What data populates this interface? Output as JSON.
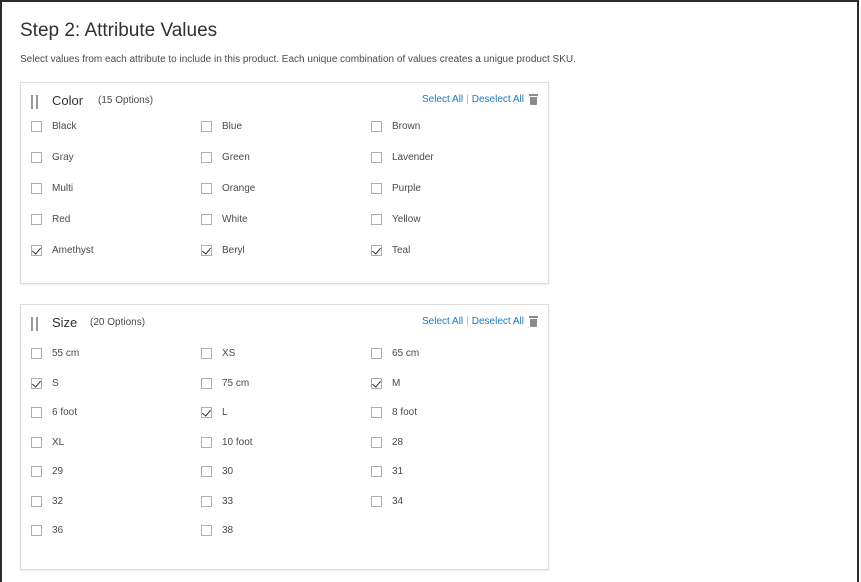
{
  "step": {
    "title": "Step 2: Attribute Values",
    "description": "Select values from each attribute to include in this product. Each unique combination of values creates a unigue product SKU."
  },
  "attributes": [
    {
      "name": "Color",
      "count_label": "(15 Options)",
      "select_all_label": "Select All",
      "deselect_all_label": "Deselect All",
      "options": [
        {
          "label": "Black",
          "checked": false
        },
        {
          "label": "Blue",
          "checked": false
        },
        {
          "label": "Brown",
          "checked": false
        },
        {
          "label": "Gray",
          "checked": false
        },
        {
          "label": "Green",
          "checked": false
        },
        {
          "label": "Lavender",
          "checked": false
        },
        {
          "label": "Multi",
          "checked": false
        },
        {
          "label": "Orange",
          "checked": false
        },
        {
          "label": "Purple",
          "checked": false
        },
        {
          "label": "Red",
          "checked": false
        },
        {
          "label": "White",
          "checked": false
        },
        {
          "label": "Yellow",
          "checked": false
        },
        {
          "label": "Amethyst",
          "checked": true
        },
        {
          "label": "Beryl",
          "checked": true
        },
        {
          "label": "Teal",
          "checked": true
        }
      ]
    },
    {
      "name": "Size",
      "count_label": "(20 Options)",
      "select_all_label": "Select All",
      "deselect_all_label": "Deselect All",
      "options": [
        {
          "label": "55 cm",
          "checked": false
        },
        {
          "label": "XS",
          "checked": false
        },
        {
          "label": "65 cm",
          "checked": false
        },
        {
          "label": "S",
          "checked": true
        },
        {
          "label": "75 cm",
          "checked": false
        },
        {
          "label": "M",
          "checked": true
        },
        {
          "label": "6 foot",
          "checked": false
        },
        {
          "label": "L",
          "checked": true
        },
        {
          "label": "8 foot",
          "checked": false
        },
        {
          "label": "XL",
          "checked": false
        },
        {
          "label": "10 foot",
          "checked": false
        },
        {
          "label": "28",
          "checked": false
        },
        {
          "label": "29",
          "checked": false
        },
        {
          "label": "30",
          "checked": false
        },
        {
          "label": "31",
          "checked": false
        },
        {
          "label": "32",
          "checked": false
        },
        {
          "label": "33",
          "checked": false
        },
        {
          "label": "34",
          "checked": false
        },
        {
          "label": "36",
          "checked": false
        },
        {
          "label": "38",
          "checked": false
        }
      ]
    }
  ],
  "colors": {
    "link": "#1979c3",
    "text": "#303030"
  }
}
